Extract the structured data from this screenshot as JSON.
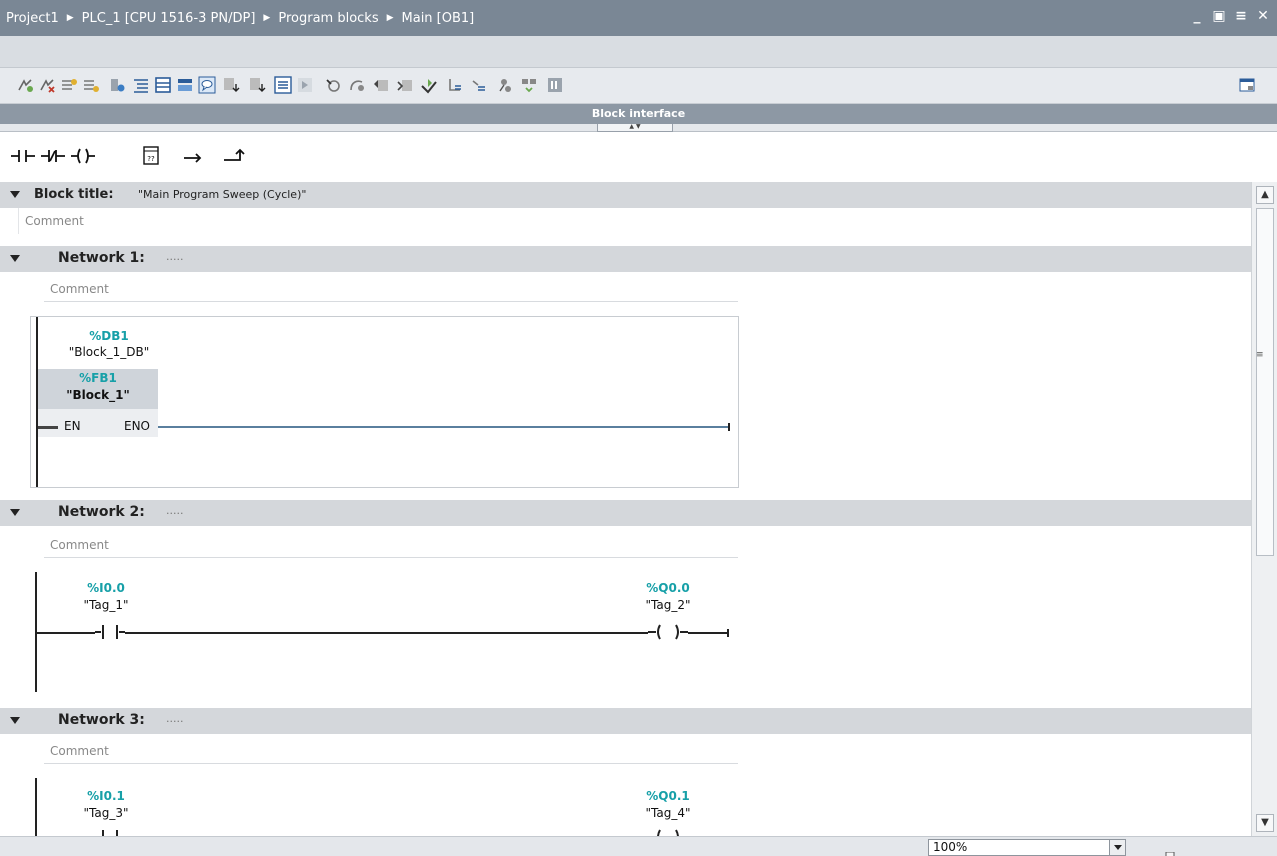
{
  "title_bar": {
    "breadcrumbs": [
      "Project1",
      "PLC_1 [CPU 1516-3 PN/DP]",
      "Program blocks",
      "Main [OB1]"
    ],
    "window_buttons": [
      "minimize-icon",
      "restore-icon",
      "float-icon",
      "close-icon"
    ]
  },
  "toolbar": {
    "icons": [
      "insert-network-icon",
      "delete-network-icon",
      "insert-row-icon",
      "add-row-icon",
      "assign-icon",
      "open-all-networks-icon",
      "close-all-networks-icon",
      "network-comments-icon",
      "comments-icon",
      "absolute-operands-icon",
      "show-tags-icon",
      "favorites-icon",
      "insert-favorites-icon",
      "monitoring-icon",
      "modify-icon",
      "call-hierarchy-icon",
      "call-environment-icon",
      "interface-icon",
      "previous-error-icon",
      "next-error-icon",
      "update-calls-icon",
      "compare-icon",
      "safety-icon"
    ],
    "right_icon": "split-view-icon"
  },
  "block_interface": {
    "label": "Block interface"
  },
  "lad_elements": [
    "no-contact-icon",
    "nc-contact-icon",
    "coil-icon",
    "empty-box-icon",
    "open-branch-icon",
    "close-branch-icon"
  ],
  "editor": {
    "block_title": {
      "label": "Block title:",
      "value": "\"Main Program Sweep (Cycle)\"",
      "comment": "Comment"
    },
    "networks": [
      {
        "label": "Network 1:",
        "dots": ".....",
        "comment": "Comment",
        "instance_db": {
          "address": "%DB1",
          "name": "\"Block_1_DB\""
        },
        "fb": {
          "address": "%FB1",
          "name": "\"Block_1\"",
          "en": "EN",
          "eno": "ENO"
        }
      },
      {
        "label": "Network 2:",
        "dots": ".....",
        "comment": "Comment",
        "contact": {
          "address": "%I0.0",
          "name": "\"Tag_1\""
        },
        "coil": {
          "address": "%Q0.0",
          "name": "\"Tag_2\""
        }
      },
      {
        "label": "Network 3:",
        "dots": ".....",
        "comment": "Comment",
        "contact": {
          "address": "%I0.1",
          "name": "\"Tag_3\""
        },
        "coil": {
          "address": "%Q0.1",
          "name": "\"Tag_4\""
        }
      }
    ]
  },
  "status_bar": {
    "zoom": "100%"
  },
  "colors": {
    "title_bar": "#7a8795",
    "operand_address": "#17a0a8",
    "section_header": "#d4d7db"
  }
}
